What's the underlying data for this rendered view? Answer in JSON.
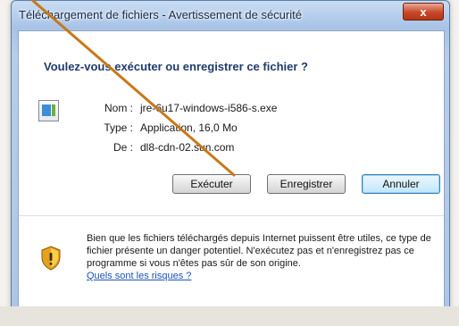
{
  "window": {
    "title": "Téléchargement de fichiers - Avertissement de sécurité",
    "close_symbol": "x"
  },
  "dialog": {
    "heading": "Voulez-vous exécuter ou enregistrer ce fichier ?",
    "file_icon": "application-file-icon",
    "fields": [
      {
        "label": "Nom :",
        "value": "jre-6u17-windows-i586-s.exe"
      },
      {
        "label": "Type :",
        "value": "Application, 16,0 Mo"
      },
      {
        "label": "De :",
        "value": "dl8-cdn-02.sun.com"
      }
    ],
    "buttons": {
      "run": "Exécuter",
      "save": "Enregistrer",
      "cancel": "Annuler"
    }
  },
  "warning": {
    "icon": "security-shield-icon",
    "text": "Bien que les fichiers téléchargés depuis Internet puissent être utiles, ce type de fichier présente un danger potentiel. N'exécutez pas et n'enregistrez pas ce programme si vous n'êtes pas sûr de son origine.",
    "link": "Quels sont les risques ?"
  },
  "colors": {
    "heading": "#1f3c6e",
    "link": "#1a52b8",
    "annotation_arrow": "#c8781a",
    "close_button": "#c8472a"
  }
}
